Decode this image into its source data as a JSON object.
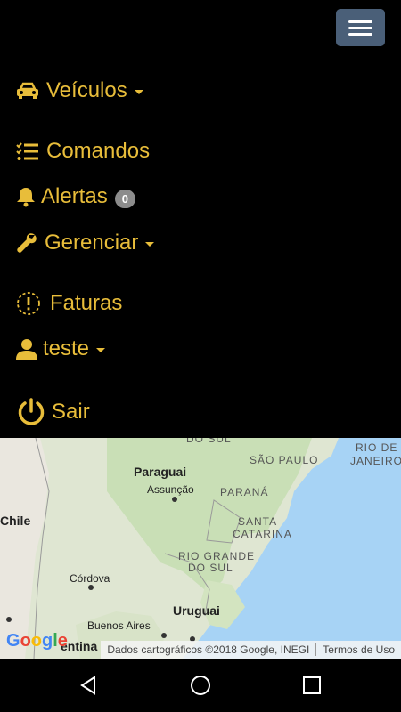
{
  "menu": {
    "veiculos": "Veículos",
    "comandos": "Comandos",
    "alertas": "Alertas",
    "alertas_count": "0",
    "gerenciar": "Gerenciar",
    "faturas": "Faturas",
    "user": "teste",
    "sair": "Sair"
  },
  "map": {
    "labels": {
      "do_sul": "DO SUL",
      "paraguai": "Paraguai",
      "assuncao": "Assunção",
      "sao_paulo": "SÃO PAULO",
      "rio_de": "RIO DE",
      "janeiro": "JANEIRO",
      "parana": "PARANÁ",
      "santa": "SANTA",
      "catarina": "CATARINA",
      "rio_grande": "RIO GRANDE",
      "do_sul2": "DO SUL",
      "chile": "Chile",
      "cordova": "Córdova",
      "uruguai": "Uruguai",
      "buenos_aires": "Buenos Aires",
      "entina": "entina"
    },
    "google": [
      "G",
      "o",
      "o",
      "g",
      "l",
      "e"
    ],
    "attribution": "Dados cartográficos ©2018 Google, INEGI",
    "terms": "Termos de Uso"
  },
  "colors": {
    "accent": "#e8bd3a",
    "water": "#a7d3f5",
    "land": "#e3ead9",
    "forest": "#c9dfb6"
  }
}
